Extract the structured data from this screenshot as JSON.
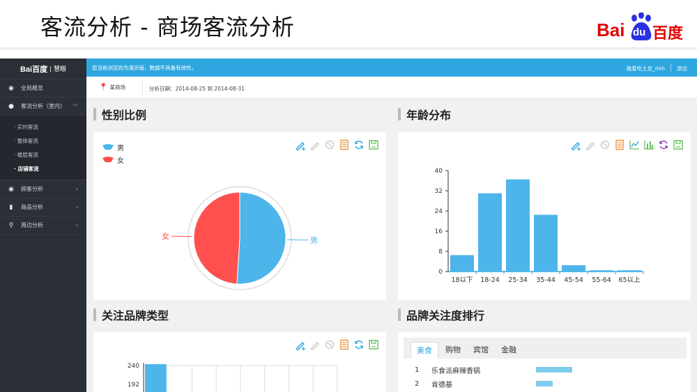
{
  "slide": {
    "title": "客流分析 - 商场客流分析",
    "logo_text_left": "Bai",
    "logo_text_mid": "du",
    "logo_text_right": "百度",
    "logo_color": "#e10602",
    "logo_paw_color": "#2932e1"
  },
  "sidebar": {
    "brand_logo": "Bai百度",
    "brand_product": "| 慧眼",
    "items": [
      {
        "label": "全局概览",
        "icon": "eye-icon"
      },
      {
        "label": "客流分析（室内）",
        "icon": "user-icon",
        "expanded": true
      },
      {
        "label": "顾客分析",
        "icon": "eye-icon"
      },
      {
        "label": "商品分析",
        "icon": "bar-chart-icon"
      },
      {
        "label": "周边分析",
        "icon": "location-icon"
      }
    ],
    "subitems": [
      "· 实时客流",
      "· 整体客流",
      "· 楼层客流",
      "· 店铺客流"
    ],
    "active_subitem": "· 店铺客流"
  },
  "topbar": {
    "notice": "您当前浏览的为演示版，数据不具备有效性。",
    "user": "我爱吃土豆_min",
    "logout": "退出",
    "color": "#2ea7e0"
  },
  "filter": {
    "store": "某商场",
    "date_range": "分析日期：2014-08-25 到 2014-08-31"
  },
  "sections": {
    "gender": "性别比例",
    "age": "年龄分布",
    "brand_type": "关注品牌类型",
    "brand_rank": "品牌关注度排行"
  },
  "gender_legend": [
    {
      "label": "男",
      "color": "#4db5ea"
    },
    {
      "label": "女",
      "color": "#ff4f4f"
    }
  ],
  "chart_data": [
    {
      "type": "pie",
      "labels": [
        "男",
        "女"
      ],
      "values": [
        51,
        49
      ],
      "colors": [
        "#4db5ea",
        "#ff4f4f"
      ]
    },
    {
      "type": "bar",
      "categories": [
        "18以下",
        "18-24",
        "25-34",
        "35-44",
        "45-54",
        "55-64",
        "65以上"
      ],
      "values": [
        6.5,
        31,
        36.5,
        22.5,
        2.5,
        0.5,
        0.5
      ],
      "ylim": [
        0,
        40
      ],
      "yticks": [
        0,
        8,
        16,
        24,
        32,
        40
      ],
      "color": "#4db5ea"
    },
    {
      "type": "bar",
      "categories": [
        "",
        "",
        "",
        "",
        "",
        "",
        "",
        ""
      ],
      "values": [
        240
      ],
      "yticks_visible": [
        "240",
        "192"
      ],
      "color": "#4db5ea"
    }
  ],
  "rank_tabs": [
    "美食",
    "购物",
    "宾馆",
    "金融"
  ],
  "active_rank_tab": "美食",
  "rank_list": [
    {
      "num": "1",
      "name": "乐食派麻辣香锅",
      "value": 1.0
    },
    {
      "num": "2",
      "name": "肯德基",
      "value": 0.47
    }
  ],
  "toolbar_icons": [
    "mark-icon",
    "erase-icon",
    "clear-icon",
    "data-view-icon",
    "refresh-icon",
    "save-icon"
  ],
  "toolbar_icons_age": [
    "mark-icon",
    "erase-icon",
    "clear-icon",
    "data-view-icon",
    "line-icon",
    "bar-icon",
    "restore-icon",
    "save-icon"
  ]
}
